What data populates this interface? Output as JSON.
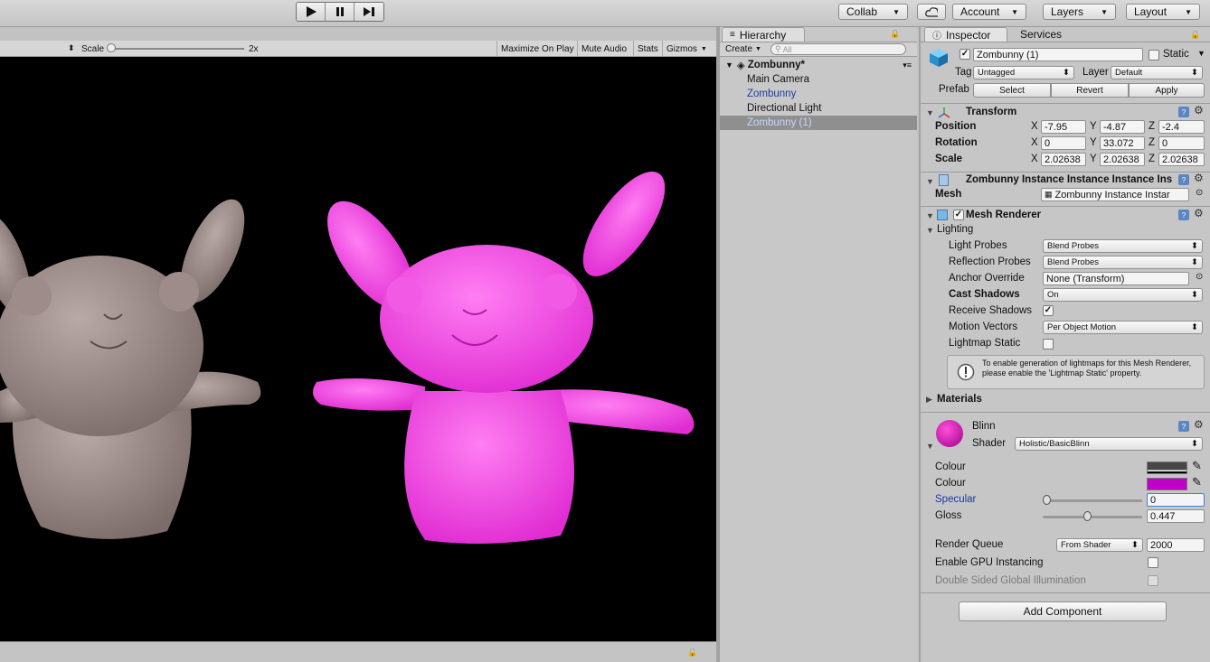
{
  "toolbar": {
    "collab": "Collab",
    "account": "Account",
    "layers": "Layers",
    "layout": "Layout"
  },
  "game": {
    "scale_label": "Scale",
    "scale_value": "2x",
    "maximize": "Maximize On Play",
    "mute": "Mute Audio",
    "stats": "Stats",
    "gizmos": "Gizmos"
  },
  "hierarchy": {
    "tab": "Hierarchy",
    "create": "Create",
    "search_placeholder": "All",
    "scene": "Zombunny*",
    "items": [
      {
        "label": "Main Camera"
      },
      {
        "label": "Zombunny"
      },
      {
        "label": "Directional Light"
      },
      {
        "label": "Zombunny (1)"
      }
    ]
  },
  "inspector": {
    "tab": "Inspector",
    "services_tab": "Services",
    "object_name": "Zombunny (1)",
    "static_label": "Static",
    "tag_label": "Tag",
    "tag_value": "Untagged",
    "layer_label": "Layer",
    "layer_value": "Default",
    "prefab_label": "Prefab",
    "select": "Select",
    "revert": "Revert",
    "apply": "Apply",
    "transform": {
      "title": "Transform",
      "position_label": "Position",
      "rotation_label": "Rotation",
      "scale_label": "Scale",
      "position": {
        "x": "-7.95",
        "y": "-4.87",
        "z": "-2.4"
      },
      "rotation": {
        "x": "0",
        "y": "33.072",
        "z": "0"
      },
      "scale": {
        "x": "2.02638",
        "y": "2.02638",
        "z": "2.02638"
      }
    },
    "meshfilter": {
      "title": "Zombunny Instance Instance Instance Ins",
      "mesh_label": "Mesh",
      "mesh_value": "Zombunny Instance Instar"
    },
    "meshrenderer": {
      "title": "Mesh Renderer",
      "lighting": "Lighting",
      "light_probes_label": "Light Probes",
      "light_probes": "Blend Probes",
      "reflection_label": "Reflection Probes",
      "reflection": "Blend Probes",
      "anchor_label": "Anchor Override",
      "anchor": "None (Transform)",
      "cast_label": "Cast Shadows",
      "cast": "On",
      "receive_label": "Receive Shadows",
      "motion_label": "Motion Vectors",
      "motion": "Per Object Motion",
      "lightmap_label": "Lightmap Static",
      "info": "To enable generation of lightmaps for this Mesh Renderer, please enable the 'Lightmap Static' property.",
      "materials": "Materials"
    },
    "material": {
      "name": "Blinn",
      "shader_label": "Shader",
      "shader": "Holistic/BasicBlinn",
      "colour1_label": "Colour",
      "colour2_label": "Colour",
      "colour2": "#c000c8",
      "specular_label": "Specular",
      "specular": "0",
      "gloss_label": "Gloss",
      "gloss": "0.447",
      "render_queue_label": "Render Queue",
      "render_queue_mode": "From Shader",
      "render_queue": "2000",
      "gpu_label": "Enable GPU Instancing",
      "dsgi_label": "Double Sided Global Illumination"
    },
    "add_component": "Add Component"
  }
}
